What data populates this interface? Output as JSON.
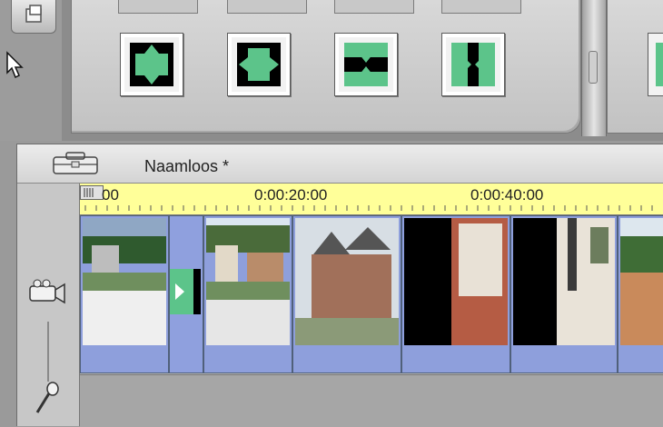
{
  "project": {
    "title": "Naamloos *"
  },
  "ruler": {
    "labels": [
      "00",
      "0:00:20:00",
      "0:00:40:00"
    ]
  },
  "transitions": [
    {
      "name": "expand-vertical"
    },
    {
      "name": "expand-horizontal"
    },
    {
      "name": "split-vertical"
    },
    {
      "name": "collapse-horizontal"
    }
  ],
  "colors": {
    "ruler": "#ffff99",
    "track": "#98a8e3",
    "transition_green": "#5cc48a"
  },
  "icons": [
    "tool-icon",
    "cursor-icon",
    "briefcase-icon",
    "camera-icon",
    "microphone-icon"
  ]
}
